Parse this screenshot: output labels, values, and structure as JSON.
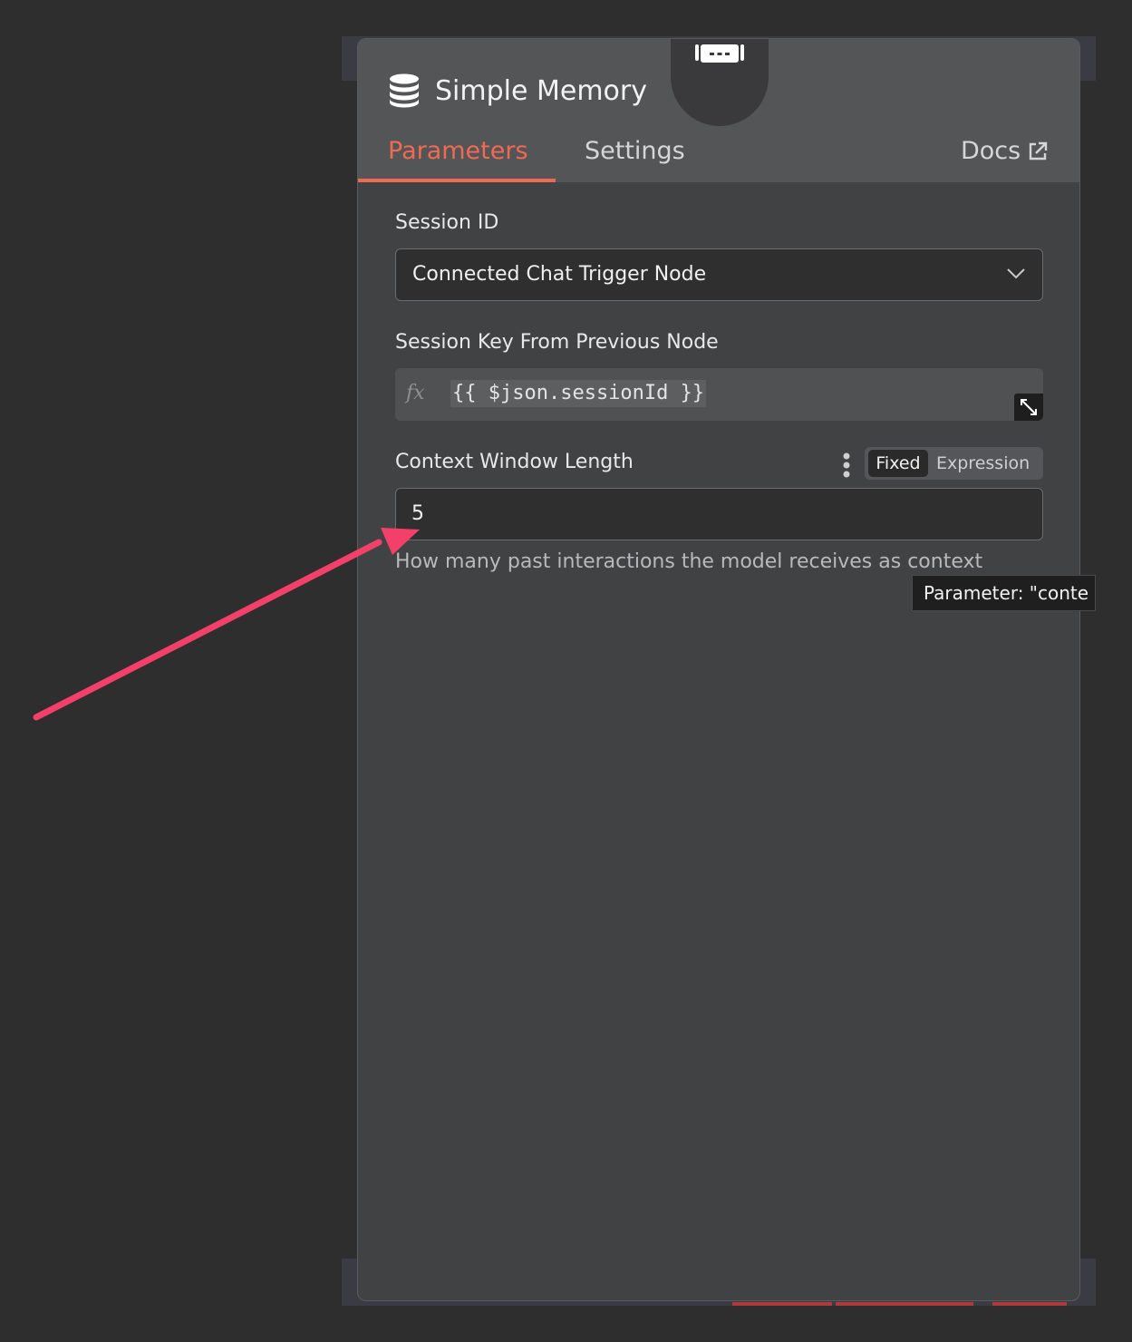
{
  "panel": {
    "title": "Simple Memory",
    "tabs": [
      {
        "label": "Parameters",
        "active": true
      },
      {
        "label": "Settings",
        "active": false
      }
    ],
    "docs_label": "Docs"
  },
  "fields": {
    "session_id": {
      "label": "Session ID",
      "value": "Connected Chat Trigger Node"
    },
    "session_key": {
      "label": "Session Key From Previous Node",
      "fx": "fx",
      "expression": "{{ $json.sessionId }}"
    },
    "context_window": {
      "label": "Context Window Length",
      "mode_fixed": "Fixed",
      "mode_expression": "Expression",
      "value": "5",
      "hint": "How many past interactions the model receives as context"
    }
  },
  "tooltip": {
    "text": "Parameter: \"conte"
  },
  "colors": {
    "accent": "#ef6a52",
    "annotation_arrow": "#f2406a",
    "panel_bg": "#414244",
    "header_bg": "#545557",
    "canvas_bg": "#2e2e2e"
  },
  "icons": {
    "title": "database-icon",
    "badge": "robot-icon",
    "docs": "external-link-icon",
    "select": "chevron-down-icon",
    "expand": "expand-icon",
    "options": "kebab-menu-icon"
  }
}
